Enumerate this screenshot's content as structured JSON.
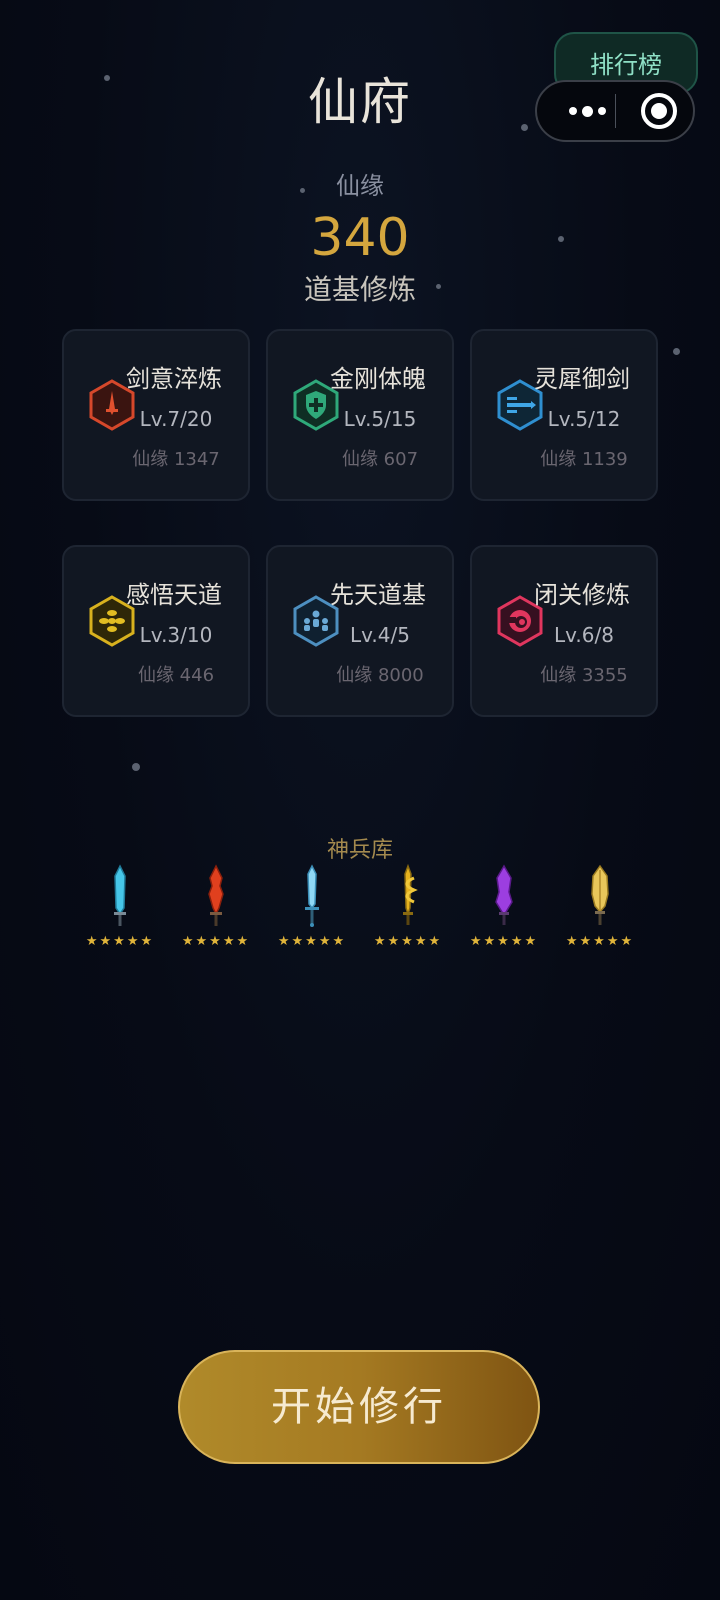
{
  "title": "仙府",
  "top_right": {
    "rank_label": "排行榜"
  },
  "capsule": {
    "more_icon": "more-dots-icon",
    "close_icon": "target-close-icon"
  },
  "currency": {
    "label": "仙缘",
    "value": "340"
  },
  "section_title": "道基修炼",
  "upgrades": [
    {
      "name": "剑意淬炼",
      "level": "Lv.7/20",
      "cost": "仙缘 1347",
      "icon": "sword-hex-icon",
      "color": "#d6482b"
    },
    {
      "name": "金刚体魄",
      "level": "Lv.5/15",
      "cost": "仙缘 607",
      "icon": "shield-plus-hex-icon",
      "color": "#2fa97a"
    },
    {
      "name": "灵犀御剑",
      "level": "Lv.5/12",
      "cost": "仙缘 1139",
      "icon": "flying-sword-hex-icon",
      "color": "#2f8fd0"
    },
    {
      "name": "感悟天道",
      "level": "Lv.3/10",
      "cost": "仙缘 446",
      "icon": "cloud-hex-icon",
      "color": "#d8b11e"
    },
    {
      "name": "先天道基",
      "level": "Lv.4/5",
      "cost": "仙缘 8000",
      "icon": "people-hex-icon",
      "color": "#4d8fc0"
    },
    {
      "name": "闭关修炼",
      "level": "Lv.6/8",
      "cost": "仙缘 3355",
      "icon": "swirl-hex-icon",
      "color": "#e0365e"
    }
  ],
  "armory": {
    "title": "神兵库",
    "weapons": [
      {
        "name": "ice-blade",
        "stars": "★★★★★",
        "color": "#46c6e8",
        "stars_count": 5
      },
      {
        "name": "flame-blade",
        "stars": "★★★★★",
        "color": "#e0401e",
        "stars_count": 5
      },
      {
        "name": "frost-blade",
        "stars": "★★★★★",
        "color": "#8fd8f5",
        "stars_count": 5
      },
      {
        "name": "golden-dragon-blade",
        "stars": "★★★★★",
        "color": "#e6b21e",
        "stars_count": 5
      },
      {
        "name": "violet-blade",
        "stars": "★★★★★",
        "color": "#9c3ee0",
        "stars_count": 5
      },
      {
        "name": "gold-feather-blade",
        "stars": "★★★★★",
        "color": "#e8c65a",
        "stars_count": 5
      }
    ]
  },
  "start_button": "开始修行",
  "colors": {
    "accent_gold": "#d4a63e",
    "background": "#070b16"
  }
}
